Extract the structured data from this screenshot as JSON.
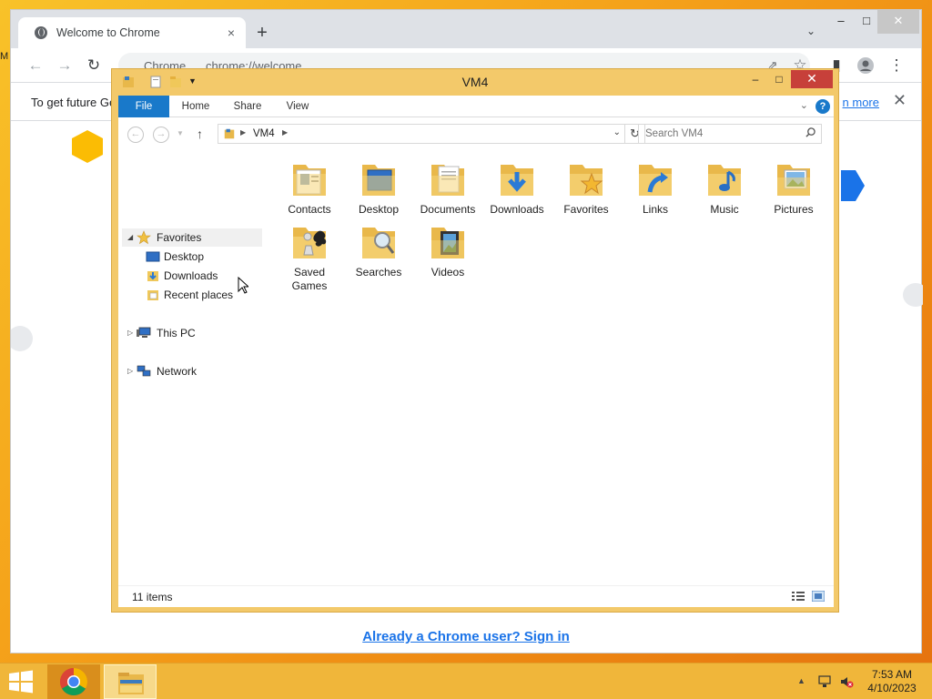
{
  "desktop": {
    "edge_label": "M"
  },
  "chrome": {
    "tab_title": "Welcome to Chrome",
    "tab_close": "×",
    "new_tab": "+",
    "tab_search": "⌄",
    "minimize": "–",
    "maximize": "□",
    "close": "✕",
    "site_label": "Chrome",
    "url": "chrome://welcome",
    "infobar_message": "To get future Ge",
    "infobar_link": "n more",
    "infobar_close": "✕",
    "signin_link": "Already a Chrome user? Sign in"
  },
  "explorer": {
    "title": "VM4",
    "minimize": "–",
    "maximize": "□",
    "close": "✕",
    "ribbon": {
      "file": "File",
      "home": "Home",
      "share": "Share",
      "view": "View",
      "help": "?"
    },
    "address": {
      "crumb": "VM4"
    },
    "search": {
      "placeholder": "Search VM4"
    },
    "nav": {
      "favorites": "Favorites",
      "desktop": "Desktop",
      "downloads": "Downloads",
      "recent": "Recent places",
      "this_pc": "This PC",
      "network": "Network"
    },
    "items": [
      {
        "label": "Contacts",
        "icon": "contacts-folder-icon"
      },
      {
        "label": "Desktop",
        "icon": "desktop-folder-icon"
      },
      {
        "label": "Documents",
        "icon": "documents-folder-icon"
      },
      {
        "label": "Downloads",
        "icon": "downloads-folder-icon"
      },
      {
        "label": "Favorites",
        "icon": "favorites-folder-icon"
      },
      {
        "label": "Links",
        "icon": "links-folder-icon"
      },
      {
        "label": "Music",
        "icon": "music-folder-icon"
      },
      {
        "label": "Pictures",
        "icon": "pictures-folder-icon"
      },
      {
        "label": "Saved Games",
        "icon": "saved-games-folder-icon"
      },
      {
        "label": "Searches",
        "icon": "searches-folder-icon"
      },
      {
        "label": "Videos",
        "icon": "videos-folder-icon"
      }
    ],
    "status": {
      "count": "11 items"
    }
  },
  "taskbar": {
    "time": "7:53 AM",
    "date": "4/10/2023"
  },
  "colors": {
    "explorer_frame": "#f3c96a",
    "ribbon_file": "#1979ca",
    "close_red": "#c7403a",
    "link_blue": "#1a73e8",
    "taskbar": "#f0b63a"
  }
}
